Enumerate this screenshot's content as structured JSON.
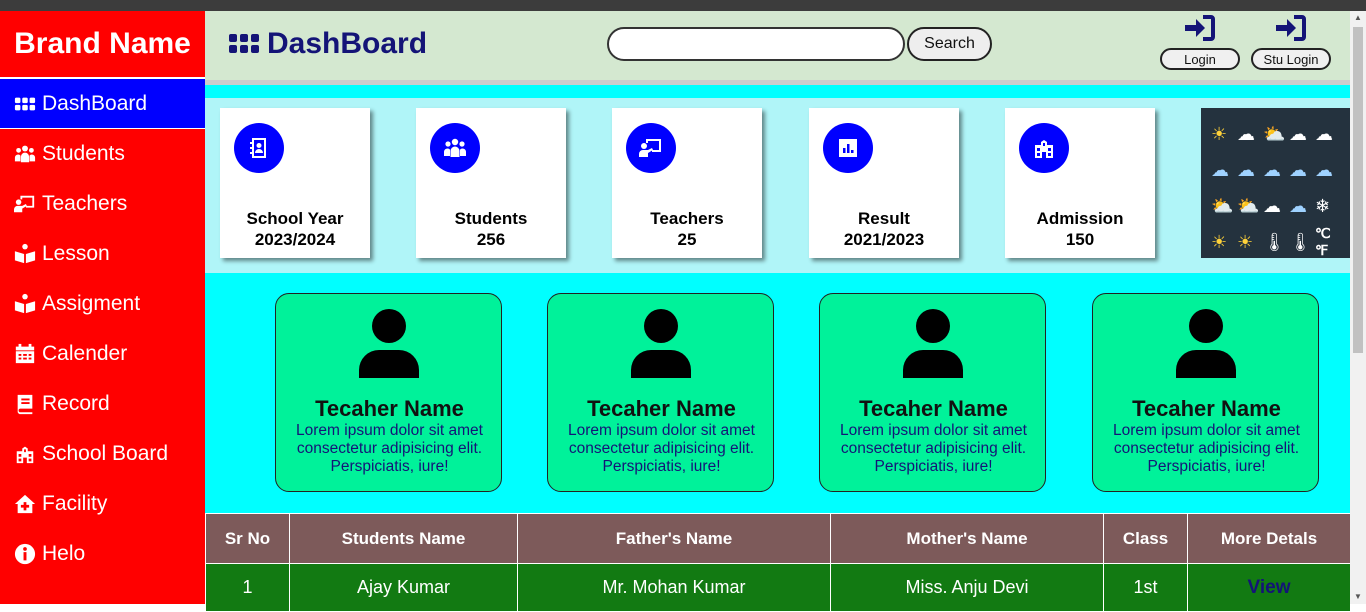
{
  "brand": "Brand Name",
  "sidebar": {
    "items": [
      {
        "label": "DashBoard",
        "icon": "grid-icon"
      },
      {
        "label": "Students",
        "icon": "users-icon"
      },
      {
        "label": "Teachers",
        "icon": "chalkboard-teacher-icon"
      },
      {
        "label": "Lesson",
        "icon": "book-reader-icon"
      },
      {
        "label": "Assigment",
        "icon": "book-reader-icon"
      },
      {
        "label": "Calender",
        "icon": "calendar-icon"
      },
      {
        "label": "Record",
        "icon": "book-icon"
      },
      {
        "label": "School Board",
        "icon": "school-icon"
      },
      {
        "label": "Facility",
        "icon": "house-plus-icon"
      },
      {
        "label": "Helo",
        "icon": "info-icon"
      }
    ]
  },
  "header": {
    "title": "DashBoard",
    "search_placeholder": "",
    "search_label": "Search",
    "login_label": "Login",
    "stu_login_label": "Stu Login"
  },
  "stats": [
    {
      "label": "School Year",
      "value": "2023/2024",
      "icon": "address-book-icon"
    },
    {
      "label": "Students",
      "value": "256",
      "icon": "users-icon"
    },
    {
      "label": "Teachers",
      "value": "25",
      "icon": "chalkboard-teacher-icon"
    },
    {
      "label": "Result",
      "value": "2021/2023",
      "icon": "chart-icon"
    },
    {
      "label": "Admission",
      "value": "150",
      "icon": "school-icon"
    }
  ],
  "teachers": [
    {
      "name": "Tecaher Name",
      "desc": "Lorem ipsum dolor sit amet consectetur adipisicing elit. Perspiciatis, iure!"
    },
    {
      "name": "Tecaher Name",
      "desc": "Lorem ipsum dolor sit amet consectetur adipisicing elit. Perspiciatis, iure!"
    },
    {
      "name": "Tecaher Name",
      "desc": "Lorem ipsum dolor sit amet consectetur adipisicing elit. Perspiciatis, iure!"
    },
    {
      "name": "Tecaher Name",
      "desc": "Lorem ipsum dolor sit amet consectetur adipisicing elit. Perspiciatis, iure!"
    }
  ],
  "table": {
    "headers": [
      "Sr No",
      "Students Name",
      "Father's Name",
      "Mother's Name",
      "Class",
      "More Detals"
    ],
    "rows": [
      [
        "1",
        "Ajay Kumar",
        "Mr. Mohan Kumar",
        "Miss. Anju Devi",
        "1st",
        "View"
      ]
    ]
  },
  "colors": {
    "sidebar": "#ff0000",
    "active_nav": "#0000ff",
    "header": "#d4e8d0",
    "main": "#00ffff",
    "teacher_card": "#00f29a",
    "table_header": "#7d5a5a",
    "table_row": "#127a12",
    "title_text": "#141477"
  }
}
